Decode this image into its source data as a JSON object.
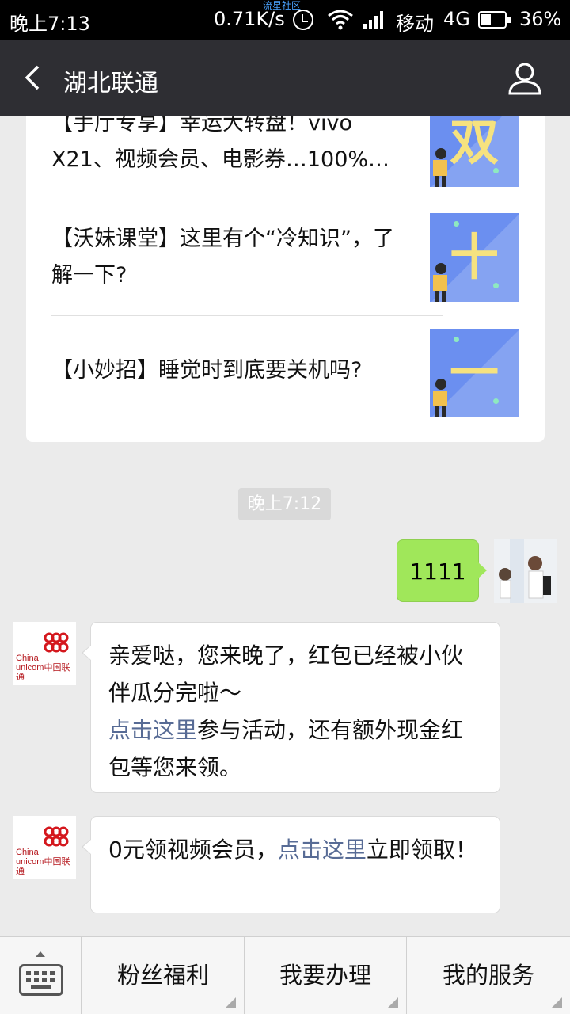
{
  "status_bar": {
    "time": "晚上7:13",
    "speed": "0.71K/s",
    "community": "流星社区",
    "carrier": "移动",
    "network": "4G",
    "battery": "36%",
    "icons": [
      "alarm-icon",
      "wifi-icon",
      "signal-icon",
      "battery-icon"
    ]
  },
  "header": {
    "title": "湖北联通",
    "back_icon": "chevron-left-icon",
    "profile_icon": "user-icon"
  },
  "articles": [
    {
      "title": "【手厅专享】幸运大转盘！vivo X21、视频会员、电影券…100%…",
      "thumb_char": "双"
    },
    {
      "title": "【沃妹课堂】这里有个“冷知识”，了解一下?",
      "thumb_char": "十"
    },
    {
      "title": "【小妙招】睡觉时到底要关机吗?",
      "thumb_char": "一"
    }
  ],
  "timestamp": "晚上7:12",
  "outgoing": {
    "text": "1111"
  },
  "bot": {
    "logo_line1": "China",
    "logo_line2": "unicom中国联通"
  },
  "incoming": [
    {
      "pre": "亲爱哒，您来晚了，红包已经被小伙伴瓜分完啦～",
      "link": "点击这里",
      "post": "参与活动，还有额外现金红包等您来领。"
    },
    {
      "pre": "0元领视频会员，",
      "link": "点击这里",
      "post": "立即领取！"
    }
  ],
  "menu": {
    "keyboard_icon": "keyboard-icon",
    "items": [
      {
        "label": "粉丝福利"
      },
      {
        "label": "我要办理"
      },
      {
        "label": "我的服务"
      }
    ]
  },
  "colors": {
    "header_bg": "#2e2e33",
    "bubble_out": "#a0e75a",
    "link": "#576b95",
    "thumb_bg": "#6b8ff0",
    "thumb_char": "#f6e27f"
  }
}
